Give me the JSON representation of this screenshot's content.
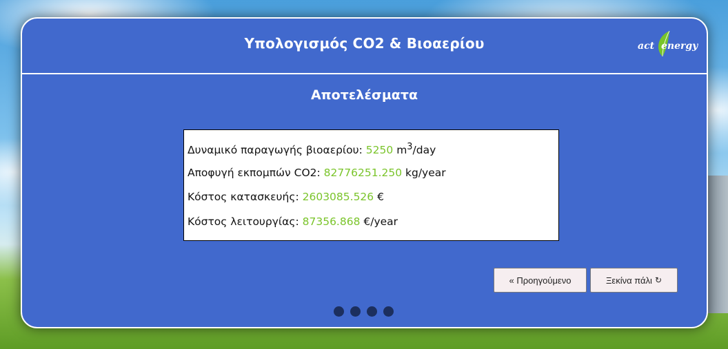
{
  "header": {
    "title": "Υπολογισμός CO2 & Βιοαερίου",
    "logo": {
      "part1": "act",
      "part2": "energy"
    }
  },
  "section": {
    "title": "Αποτελέσματα"
  },
  "results": [
    {
      "label": "Δυναμικό παραγωγής βιοαερίου:",
      "value": "5250",
      "unit_base": "m",
      "unit_sup": "3",
      "unit_rest": "/day"
    },
    {
      "label": "Αποφυγή εκπομπών CO2:",
      "value": "82776251.250",
      "unit": "kg/year"
    },
    {
      "label": "Κόστος κατασκευής:",
      "value": "2603085.526",
      "unit": "€"
    },
    {
      "label": "Κόστος λειτουργίας:",
      "value": "87356.868",
      "unit": "€/year"
    }
  ],
  "buttons": {
    "prev": "« Προηγούμενο",
    "restart": "Ξεκίνα πάλι",
    "restart_icon": "↻"
  },
  "colors": {
    "panel": "#4169cd",
    "value_accent": "#7ac42a",
    "dot": "#1c2f5e"
  },
  "icons": [
    "refresh-icon",
    "leaf-icon"
  ]
}
